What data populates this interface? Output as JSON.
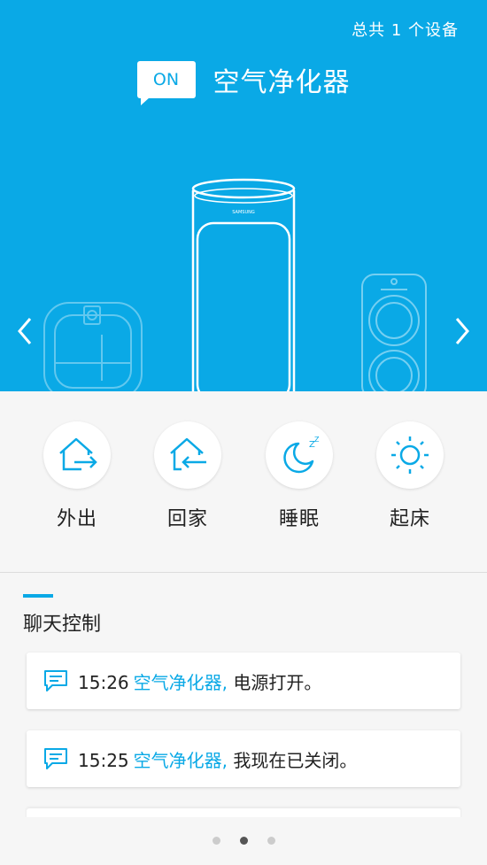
{
  "header": {
    "device_count_text": "总共 1 个设备",
    "power_badge": "ON",
    "device_name": "空气净化器"
  },
  "carousel": {
    "prev_icon": "chevron-left-icon",
    "next_icon": "chevron-right-icon",
    "brand_text": "SAMSUNG"
  },
  "shortcuts": [
    {
      "label": "外出",
      "icon": "leave-home-icon"
    },
    {
      "label": "回家",
      "icon": "come-home-icon"
    },
    {
      "label": "睡眠",
      "icon": "moon-sleep-icon"
    },
    {
      "label": "起床",
      "icon": "sun-icon"
    }
  ],
  "chat": {
    "title": "聊天控制",
    "messages": [
      {
        "time": "15:26",
        "device": "空气净化器,",
        "text": "电源打开。"
      },
      {
        "time": "15:25",
        "device": "空气净化器,",
        "text": "我现在已关闭。"
      }
    ]
  },
  "pagination": {
    "total": 3,
    "active": 2
  },
  "colors": {
    "accent": "#0aa9e6",
    "background": "#f6f6f6"
  }
}
